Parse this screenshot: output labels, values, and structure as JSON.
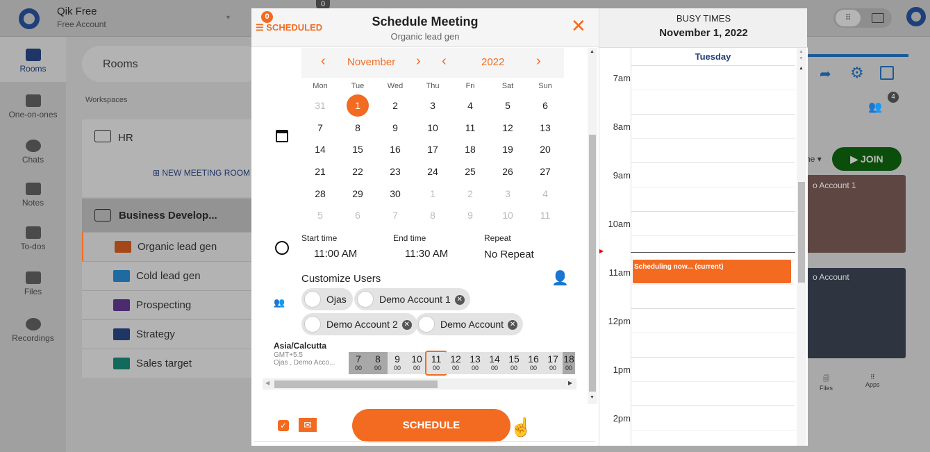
{
  "app": {
    "name": "Qik Free",
    "account": "Free Account",
    "badge": "0"
  },
  "sidebar": {
    "items": [
      {
        "label": "Rooms",
        "active": true
      },
      {
        "label": "One-on-ones"
      },
      {
        "label": "Chats"
      },
      {
        "label": "Notes"
      },
      {
        "label": "To-dos"
      },
      {
        "label": "Files"
      },
      {
        "label": "Recordings"
      }
    ]
  },
  "rooms": {
    "search": "Rooms",
    "workspaces_label": "Workspaces",
    "hr": "HR",
    "new_room": "NEW MEETING ROOM",
    "business": "Business Develop...",
    "list": [
      {
        "name": "Organic lead gen",
        "color": "#a4481a"
      },
      {
        "name": "Cold lead gen",
        "color": "#1f6aa0"
      },
      {
        "name": "Prospecting",
        "color": "#4b2a70"
      },
      {
        "name": "Strategy",
        "color": "#1f3566"
      },
      {
        "name": "Sales target",
        "color": "#126a5c"
      }
    ]
  },
  "room_panel": {
    "participants_count": "4",
    "join": "JOIN",
    "tile1": "o Account 1",
    "tile2": "o Account",
    "files": "Files",
    "apps": "Apps",
    "mode": "ne"
  },
  "modal": {
    "scheduled_label": "SCHEDULED",
    "scheduled_count": "0",
    "title": "Schedule Meeting",
    "subtitle": "Organic lead gen",
    "month": "November",
    "year": "2022",
    "weekdays": [
      "Mon",
      "Tue",
      "Wed",
      "Thu",
      "Fri",
      "Sat",
      "Sun"
    ],
    "weeks": [
      [
        "31",
        "1",
        "2",
        "3",
        "4",
        "5",
        "6"
      ],
      [
        "7",
        "8",
        "9",
        "10",
        "11",
        "12",
        "13"
      ],
      [
        "14",
        "15",
        "16",
        "17",
        "18",
        "19",
        "20"
      ],
      [
        "21",
        "22",
        "23",
        "24",
        "25",
        "26",
        "27"
      ],
      [
        "28",
        "29",
        "30",
        "1",
        "2",
        "3",
        "4"
      ],
      [
        "5",
        "6",
        "7",
        "8",
        "9",
        "10",
        "11"
      ]
    ],
    "selected_day": "1",
    "start_label": "Start time",
    "start": "11:00 AM",
    "end_label": "End time",
    "end": "11:30 AM",
    "repeat_label": "Repeat",
    "repeat": "No Repeat",
    "users_label": "Customize Users",
    "users": [
      "Ojas",
      "Demo Account 1",
      "Demo Account 2",
      "Demo Account"
    ],
    "tz": {
      "name": "Asia/Calcutta",
      "offset": "GMT+5.5",
      "people": "Ojas , Demo Acco...",
      "hours": [
        "7",
        "8",
        "9",
        "10",
        "11",
        "12",
        "13",
        "14",
        "15",
        "16",
        "17",
        "18"
      ],
      "minutes": "00",
      "selected": "11"
    },
    "schedule": "SCHEDULE",
    "email_checked": true
  },
  "busy": {
    "title": "BUSY TIMES",
    "date": "November 1, 2022",
    "day": "Tuesday",
    "hours": [
      "7am",
      "8am",
      "9am",
      "10am",
      "11am",
      "12pm",
      "1pm",
      "2pm"
    ],
    "event": "Scheduling now... (current)"
  },
  "colors": {
    "accent": "#f26b21",
    "brand": "#1f3f7a",
    "join": "#0b4d0b"
  }
}
